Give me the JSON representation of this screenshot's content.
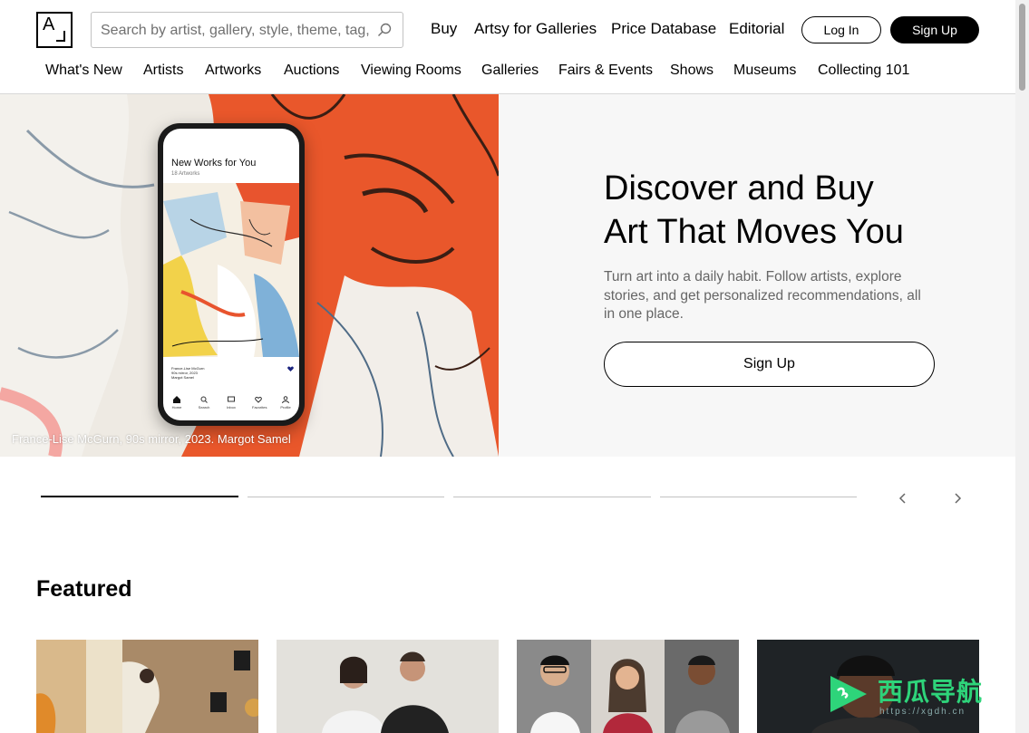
{
  "header": {
    "logo_letter": "A",
    "search_placeholder": "Search by artist, gallery, style, theme, tag, etc.",
    "top_nav": [
      "Buy",
      "Artsy for Galleries",
      "Price Database",
      "Editorial"
    ],
    "login_label": "Log In",
    "signup_label": "Sign Up",
    "sub_nav": [
      "What's New",
      "Artists",
      "Artworks",
      "Auctions",
      "Viewing Rooms",
      "Galleries",
      "Fairs & Events",
      "Shows",
      "Museums",
      "Collecting 101"
    ]
  },
  "hero": {
    "caption": "France-Lise McGurn, 90s mirror, 2023. Margot Samel",
    "heading_line1": "Discover and Buy",
    "heading_line2": "Art That Moves You",
    "text": "Turn art into a daily habit. Follow artists, explore stories, and get personalized recommendations, all in one place.",
    "cta_label": "Sign Up",
    "phone": {
      "title": "New Works for You",
      "subtitle": "18 Artworks",
      "meta_artist": "France-Lise McGurn",
      "meta_title": "90s mirror, 2023",
      "meta_gallery": "Margot Samel",
      "tabs": [
        "Home",
        "Search",
        "Inbox",
        "Favorites",
        "Profile"
      ]
    }
  },
  "carousel": {
    "slides": 4,
    "active_index": 0
  },
  "featured": {
    "title": "Featured"
  },
  "watermark": {
    "text": "西瓜导航",
    "url": "https://xgdh.cn"
  },
  "colors": {
    "hero_bg": "#f7f7f7",
    "accent_orange": "#e85a2e",
    "watermark_green": "#2ed47a"
  }
}
